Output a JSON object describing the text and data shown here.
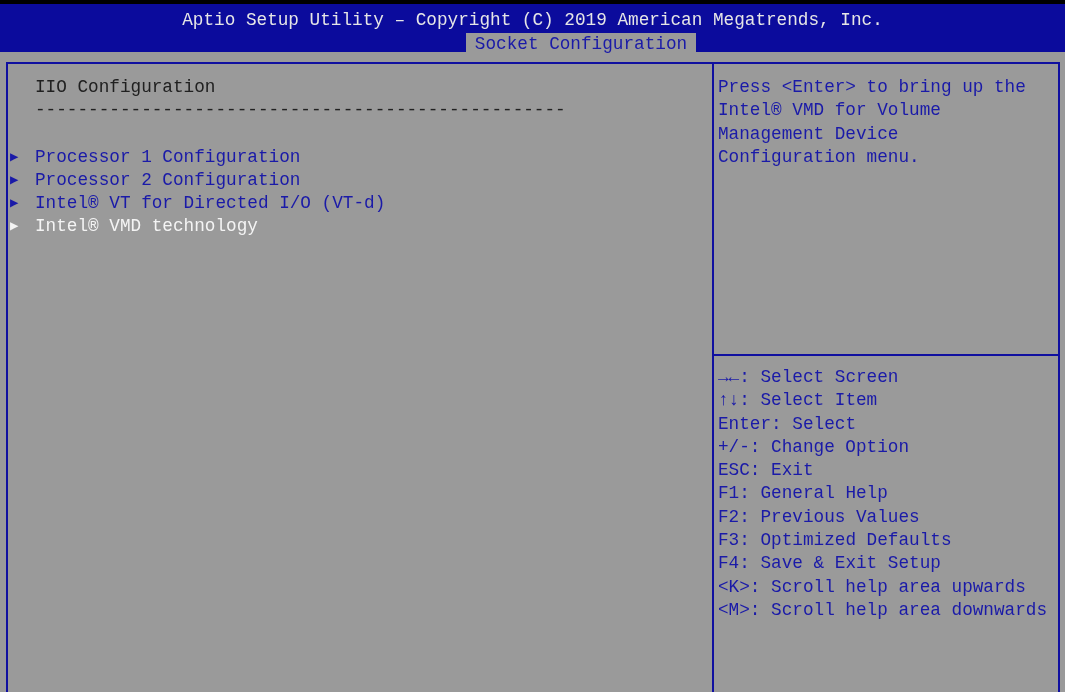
{
  "header": {
    "title": "Aptio Setup Utility – Copyright (C) 2019 American Megatrends, Inc.",
    "tabs": [
      {
        "label": "Socket Configuration",
        "selected": true
      }
    ]
  },
  "main": {
    "section_title": "IIO Configuration",
    "separator": "--------------------------------------------------",
    "items": [
      {
        "marker": "▶",
        "label": "Processor 1 Configuration",
        "selected": false
      },
      {
        "marker": "▶",
        "label": "Processor 2 Configuration",
        "selected": false
      },
      {
        "marker": "▶",
        "label": "Intel® VT for Directed I/O (VT-d)",
        "selected": false
      },
      {
        "marker": "▶",
        "label": "Intel® VMD technology",
        "selected": true
      }
    ]
  },
  "help": {
    "lines": [
      "Press <Enter> to bring up the",
      "Intel® VMD for Volume",
      "Management Device",
      "Configuration menu."
    ],
    "keys": [
      {
        "key": "→←",
        "action": ": Select Screen"
      },
      {
        "key": "↑↓",
        "action": ": Select Item"
      },
      {
        "key": "Enter",
        "action": ": Select"
      },
      {
        "key": "+/-",
        "action": ": Change Option"
      },
      {
        "key": "ESC",
        "action": ": Exit"
      },
      {
        "key": "F1",
        "action": ": General Help"
      },
      {
        "key": "F2",
        "action": ": Previous Values"
      },
      {
        "key": "F3",
        "action": ": Optimized Defaults"
      },
      {
        "key": "F4",
        "action": ": Save & Exit Setup"
      },
      {
        "key": "<K>",
        "action": ": Scroll help area upwards"
      },
      {
        "key": "<M>",
        "action": ": Scroll help area downwards"
      }
    ]
  }
}
